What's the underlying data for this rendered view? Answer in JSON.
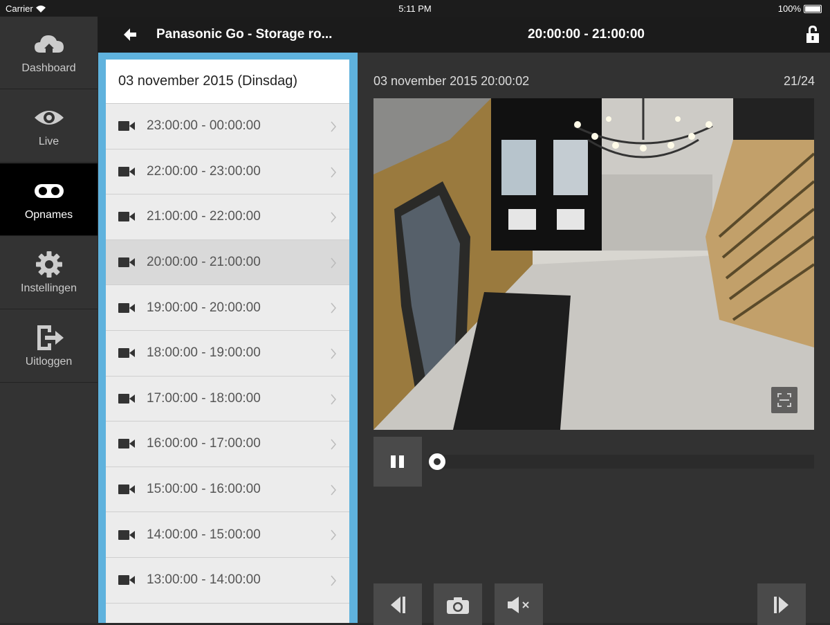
{
  "status_bar": {
    "carrier": "Carrier",
    "time": "5:11 PM",
    "battery": "100%"
  },
  "sidebar": {
    "items": [
      {
        "label": "Dashboard",
        "icon": "cloud-home-icon"
      },
      {
        "label": "Live",
        "icon": "eye-icon"
      },
      {
        "label": "Opnames",
        "icon": "recordings-icon",
        "active": true
      },
      {
        "label": "Instellingen",
        "icon": "gear-icon"
      },
      {
        "label": "Uitloggen",
        "icon": "logout-icon"
      }
    ]
  },
  "header": {
    "title": "Panasonic Go - Storage ro...",
    "range": "20:00:00 - 21:00:00"
  },
  "list": {
    "date_header": "03 november 2015 (Dinsdag)",
    "rows": [
      "23:00:00 - 00:00:00",
      "22:00:00 - 23:00:00",
      "21:00:00 - 22:00:00",
      "20:00:00 - 21:00:00",
      "19:00:00 - 20:00:00",
      "18:00:00 - 19:00:00",
      "17:00:00 - 18:00:00",
      "16:00:00 - 17:00:00",
      "15:00:00 - 16:00:00",
      "14:00:00 - 15:00:00",
      "13:00:00 - 14:00:00"
    ],
    "selected_index": 3
  },
  "player": {
    "timestamp": "03 november 2015 20:00:02",
    "counter": "21/24",
    "progress": 0
  },
  "colors": {
    "accent": "#5fb2dd",
    "active_nav": "#000000"
  }
}
